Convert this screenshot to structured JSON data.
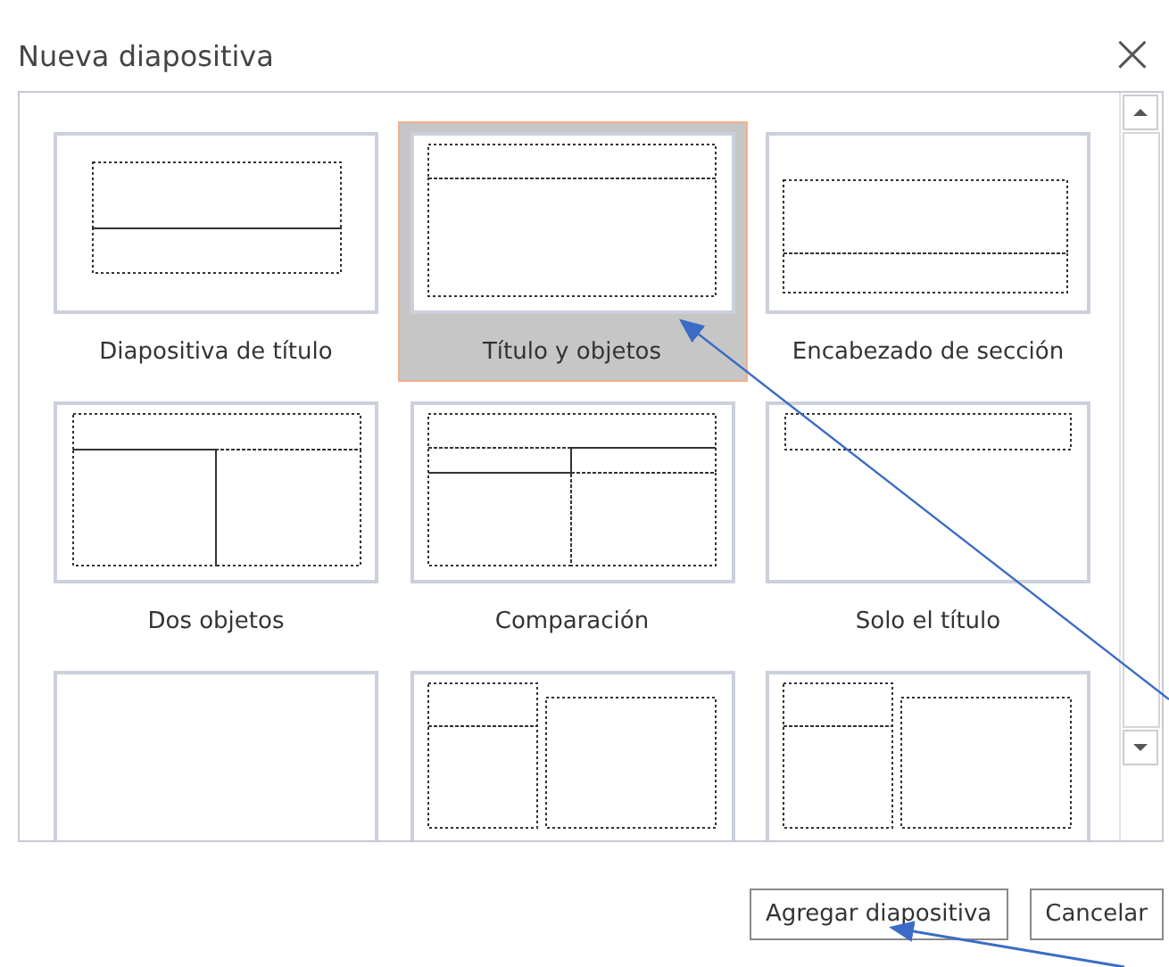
{
  "dialog": {
    "title": "Nueva diapositiva",
    "close": "×"
  },
  "layouts": [
    {
      "kind": "title",
      "label": "Diapositiva de título",
      "selected": false
    },
    {
      "kind": "title-content",
      "label": "Título y objetos",
      "selected": true
    },
    {
      "kind": "section-header",
      "label": "Encabezado de sección",
      "selected": false
    },
    {
      "kind": "two-content",
      "label": "Dos objetos",
      "selected": false
    },
    {
      "kind": "comparison",
      "label": "Comparación",
      "selected": false
    },
    {
      "kind": "title-only",
      "label": "Solo el título",
      "selected": false
    },
    {
      "kind": "blank",
      "selected": false
    },
    {
      "kind": "content-caption",
      "selected": false
    },
    {
      "kind": "picture-caption",
      "selected": false
    }
  ],
  "buttons": [
    "Agregar diapositiva",
    "Cancelar"
  ]
}
